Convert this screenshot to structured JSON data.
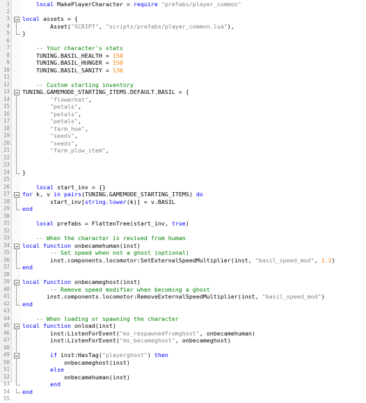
{
  "editor": {
    "lines": [
      {
        "n": "1",
        "fold": "none",
        "t": [
          [
            "    ",
            ""
          ],
          [
            "local",
            "k"
          ],
          [
            " MakePlayerCharacter = ",
            ""
          ],
          [
            "require",
            "k"
          ],
          [
            " ",
            ""
          ],
          [
            "\"prefabs/player_common\"",
            "s"
          ]
        ]
      },
      {
        "n": "2",
        "fold": "none",
        "t": []
      },
      {
        "n": "3",
        "fold": "start",
        "t": [
          [
            "local",
            "k"
          ],
          [
            " assets = {",
            ""
          ]
        ]
      },
      {
        "n": "4",
        "fold": "line",
        "t": [
          [
            "        Asset(",
            ""
          ],
          [
            "\"SCRIPT\"",
            "s"
          ],
          [
            ", ",
            ""
          ],
          [
            "\"scripts/prefabs/player_common.lua\"",
            "s"
          ],
          [
            "),",
            ""
          ]
        ]
      },
      {
        "n": "5",
        "fold": "end",
        "t": [
          [
            "}",
            ""
          ]
        ]
      },
      {
        "n": "6",
        "fold": "none",
        "t": []
      },
      {
        "n": "7",
        "fold": "none",
        "t": [
          [
            "    ",
            ""
          ],
          [
            "-- Your character's stats",
            "c"
          ]
        ]
      },
      {
        "n": "8",
        "fold": "none",
        "t": [
          [
            "    TUNING.BASIL_HEALTH = ",
            ""
          ],
          [
            "150",
            "n"
          ]
        ]
      },
      {
        "n": "9",
        "fold": "none",
        "t": [
          [
            "    TUNING.BASIL_HUNGER = ",
            ""
          ],
          [
            "150",
            "n"
          ]
        ]
      },
      {
        "n": "10",
        "fold": "none",
        "t": [
          [
            "    TUNING.BASIL_SANITY = ",
            ""
          ],
          [
            "130",
            "n"
          ]
        ]
      },
      {
        "n": "11",
        "fold": "none",
        "t": []
      },
      {
        "n": "12",
        "fold": "none",
        "t": [
          [
            "    ",
            ""
          ],
          [
            "-- Custom starting inventory",
            "c"
          ]
        ]
      },
      {
        "n": "13",
        "fold": "start",
        "t": [
          [
            "TUNING.GAMEMODE_STARTING_ITEMS.DEFAULT.BASIL = {",
            ""
          ]
        ]
      },
      {
        "n": "14",
        "fold": "line",
        "t": [
          [
            "        ",
            ""
          ],
          [
            "\"flowerhat\"",
            "s"
          ],
          [
            ",",
            ""
          ]
        ]
      },
      {
        "n": "15",
        "fold": "line",
        "t": [
          [
            "        ",
            ""
          ],
          [
            "\"petals\"",
            "s"
          ],
          [
            ",",
            ""
          ]
        ]
      },
      {
        "n": "16",
        "fold": "line",
        "t": [
          [
            "        ",
            ""
          ],
          [
            "\"petals\"",
            "s"
          ],
          [
            ",",
            ""
          ]
        ]
      },
      {
        "n": "17",
        "fold": "line",
        "t": [
          [
            "        ",
            ""
          ],
          [
            "\"petals\"",
            "s"
          ],
          [
            ",",
            ""
          ]
        ]
      },
      {
        "n": "18",
        "fold": "line",
        "t": [
          [
            "        ",
            ""
          ],
          [
            "\"farm_hoe\"",
            "s"
          ],
          [
            ",",
            ""
          ]
        ]
      },
      {
        "n": "19",
        "fold": "line",
        "t": [
          [
            "        ",
            ""
          ],
          [
            "\"seeds\"",
            "s"
          ],
          [
            ",",
            ""
          ]
        ]
      },
      {
        "n": "20",
        "fold": "line",
        "t": [
          [
            "        ",
            ""
          ],
          [
            "\"seeds\"",
            "s"
          ],
          [
            ",",
            ""
          ]
        ]
      },
      {
        "n": "21",
        "fold": "line",
        "t": [
          [
            "        ",
            ""
          ],
          [
            "\"farm_plow_item\"",
            "s"
          ],
          [
            ",",
            ""
          ]
        ]
      },
      {
        "n": "22",
        "fold": "line",
        "t": []
      },
      {
        "n": "23",
        "fold": "line",
        "t": []
      },
      {
        "n": "24",
        "fold": "end",
        "t": [
          [
            "}",
            ""
          ]
        ]
      },
      {
        "n": "25",
        "fold": "none",
        "t": []
      },
      {
        "n": "26",
        "fold": "none",
        "t": [
          [
            "    ",
            ""
          ],
          [
            "local",
            "k"
          ],
          [
            " start_inv = {}",
            ""
          ]
        ]
      },
      {
        "n": "27",
        "fold": "start",
        "t": [
          [
            "for",
            "k"
          ],
          [
            " k, v ",
            ""
          ],
          [
            "in",
            "k"
          ],
          [
            " ",
            ""
          ],
          [
            "pairs",
            "k"
          ],
          [
            "(TUNING.GAMEMODE_STARTING_ITEMS) ",
            ""
          ],
          [
            "do",
            "k"
          ]
        ]
      },
      {
        "n": "28",
        "fold": "line",
        "t": [
          [
            "        start_inv[",
            ""
          ],
          [
            "string.lower",
            "k"
          ],
          [
            "(k)] = v.BASIL",
            ""
          ]
        ]
      },
      {
        "n": "29",
        "fold": "end",
        "t": [
          [
            "end",
            "k"
          ]
        ]
      },
      {
        "n": "30",
        "fold": "none",
        "t": []
      },
      {
        "n": "31",
        "fold": "none",
        "t": [
          [
            "    ",
            ""
          ],
          [
            "local",
            "k"
          ],
          [
            " prefabs = FlattenTree(start_inv, ",
            ""
          ],
          [
            "true",
            "k"
          ],
          [
            ")",
            ""
          ]
        ]
      },
      {
        "n": "32",
        "fold": "none",
        "t": []
      },
      {
        "n": "33",
        "fold": "none",
        "t": [
          [
            "    ",
            ""
          ],
          [
            "-- When the character is revived from human",
            "c"
          ]
        ]
      },
      {
        "n": "34",
        "fold": "start",
        "t": [
          [
            "local",
            "k"
          ],
          [
            " ",
            ""
          ],
          [
            "function",
            "k"
          ],
          [
            " onbecamehuman(inst)",
            ""
          ]
        ]
      },
      {
        "n": "35",
        "fold": "line",
        "t": [
          [
            "        ",
            ""
          ],
          [
            "-- Set speed when not a ghost (optional)",
            "c"
          ]
        ]
      },
      {
        "n": "36",
        "fold": "line",
        "t": [
          [
            "        inst.components.locomotor:SetExternalSpeedMultiplier(inst, ",
            ""
          ],
          [
            "\"basil_speed_mod\"",
            "s"
          ],
          [
            ", ",
            ""
          ],
          [
            "1.2",
            "n"
          ],
          [
            ")",
            ""
          ]
        ]
      },
      {
        "n": "37",
        "fold": "end",
        "t": [
          [
            "end",
            "k"
          ]
        ]
      },
      {
        "n": "38",
        "fold": "none",
        "t": []
      },
      {
        "n": "39",
        "fold": "start",
        "t": [
          [
            "local",
            "k"
          ],
          [
            " ",
            ""
          ],
          [
            "function",
            "k"
          ],
          [
            " onbecameghost(inst)",
            ""
          ]
        ]
      },
      {
        "n": "40",
        "fold": "line",
        "t": [
          [
            "        ",
            ""
          ],
          [
            "-- Remove speed modifier when becoming a ghost",
            "c"
          ]
        ]
      },
      {
        "n": "41",
        "fold": "line",
        "t": [
          [
            "       inst.components.locomotor:RemoveExternalSpeedMultiplier(inst, ",
            ""
          ],
          [
            "\"basil_speed_mod\"",
            "s"
          ],
          [
            ")",
            ""
          ]
        ]
      },
      {
        "n": "42",
        "fold": "end",
        "t": [
          [
            "end",
            "k"
          ]
        ]
      },
      {
        "n": "43",
        "fold": "none",
        "t": []
      },
      {
        "n": "44",
        "fold": "none",
        "t": [
          [
            "    ",
            ""
          ],
          [
            "-- When loading or spawning the character",
            "c"
          ]
        ]
      },
      {
        "n": "45",
        "fold": "start",
        "t": [
          [
            "local",
            "k"
          ],
          [
            " ",
            ""
          ],
          [
            "function",
            "k"
          ],
          [
            " onload(inst)",
            ""
          ]
        ]
      },
      {
        "n": "46",
        "fold": "line",
        "t": [
          [
            "        inst:ListenForEvent(",
            ""
          ],
          [
            "\"ms_respawnedfromghost\"",
            "s"
          ],
          [
            ", onbecamehuman)",
            ""
          ]
        ]
      },
      {
        "n": "47",
        "fold": "line",
        "t": [
          [
            "        inst:ListenForEvent(",
            ""
          ],
          [
            "\"ms_becameghost\"",
            "s"
          ],
          [
            ", onbecameghost)",
            ""
          ]
        ]
      },
      {
        "n": "48",
        "fold": "line",
        "t": []
      },
      {
        "n": "49",
        "fold": "start",
        "t": [
          [
            "        ",
            ""
          ],
          [
            "if",
            "k"
          ],
          [
            " inst:HasTag(",
            ""
          ],
          [
            "\"playerghost\"",
            "s"
          ],
          [
            ") ",
            ""
          ],
          [
            "then",
            "k"
          ]
        ]
      },
      {
        "n": "50",
        "fold": "line",
        "t": [
          [
            "            onbecameghost(inst)",
            ""
          ]
        ]
      },
      {
        "n": "51",
        "fold": "line",
        "t": [
          [
            "        ",
            ""
          ],
          [
            "else",
            "k"
          ]
        ]
      },
      {
        "n": "52",
        "fold": "line",
        "t": [
          [
            "            onbecamehuman(inst)",
            ""
          ]
        ]
      },
      {
        "n": "53",
        "fold": "end",
        "t": [
          [
            "        ",
            ""
          ],
          [
            "end",
            "k"
          ]
        ]
      },
      {
        "n": "54",
        "fold": "end",
        "t": [
          [
            "end",
            "k"
          ]
        ]
      },
      {
        "n": "55",
        "fold": "none",
        "t": []
      }
    ]
  }
}
